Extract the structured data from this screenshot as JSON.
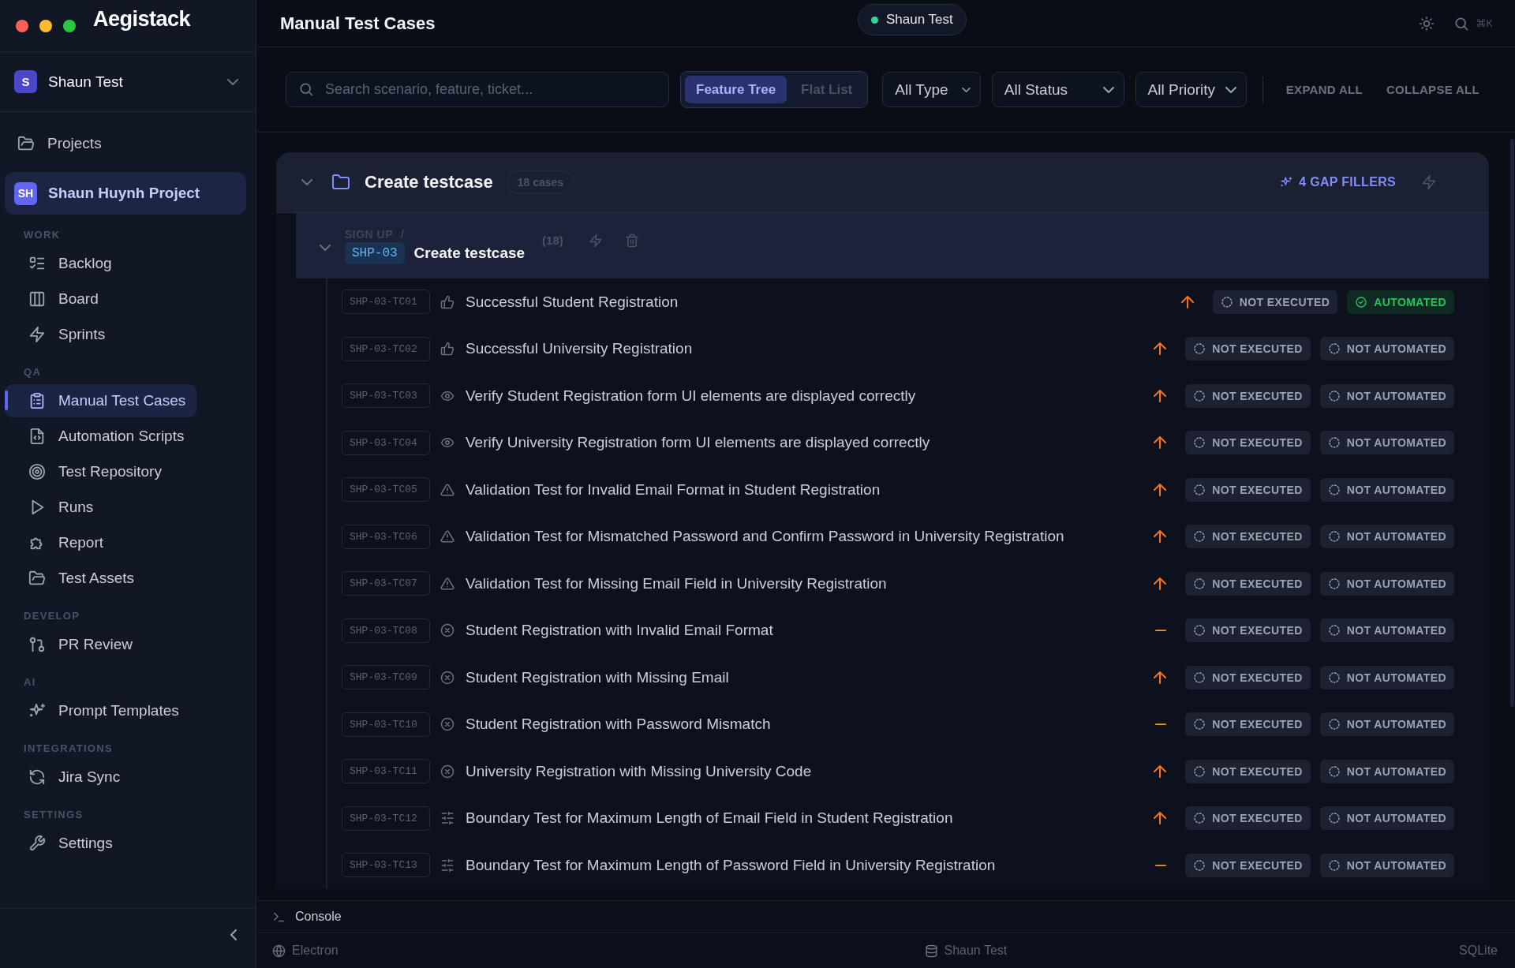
{
  "app": {
    "logo": "Aegistack"
  },
  "workspace": {
    "avatar": "S",
    "name": "Shaun Test"
  },
  "sidebar": {
    "projects_label": "Projects",
    "project": {
      "avatar": "SH",
      "name": "Shaun Huynh Project",
      "selected": true
    },
    "sections": [
      {
        "title": "WORK",
        "items": [
          {
            "kind": "backlog",
            "label": "Backlog",
            "selected": false
          },
          {
            "kind": "board",
            "label": "Board",
            "selected": false
          },
          {
            "kind": "sprints",
            "label": "Sprints",
            "selected": false
          }
        ]
      },
      {
        "title": "QA",
        "items": [
          {
            "kind": "manual",
            "label": "Manual Test Cases",
            "selected": true
          },
          {
            "kind": "scripts",
            "label": "Automation Scripts",
            "selected": false
          },
          {
            "kind": "repository",
            "label": "Test Repository",
            "selected": false
          },
          {
            "kind": "runs",
            "label": "Runs",
            "selected": false
          },
          {
            "kind": "report",
            "label": "Report",
            "selected": false
          },
          {
            "kind": "assets",
            "label": "Test Assets",
            "selected": false
          }
        ]
      },
      {
        "title": "DEVELOP",
        "items": [
          {
            "kind": "pr",
            "label": "PR Review",
            "selected": false
          }
        ]
      },
      {
        "title": "AI",
        "items": [
          {
            "kind": "prompts",
            "label": "Prompt Templates",
            "selected": false
          }
        ]
      },
      {
        "title": "INTEGRATIONS",
        "items": [
          {
            "kind": "sync",
            "label": "Jira Sync",
            "selected": false
          }
        ]
      },
      {
        "title": "SETTINGS",
        "items": [
          {
            "kind": "settings",
            "label": "Settings",
            "selected": false
          }
        ]
      }
    ]
  },
  "header": {
    "title": "Manual Test Cases",
    "connection": {
      "label": "Shaun Test",
      "online": true
    },
    "shortcut": "⌘K"
  },
  "filters": {
    "search": {
      "placeholder": "Search scenario, feature, ticket..."
    },
    "views": [
      {
        "label": "Feature Tree",
        "selected": true
      },
      {
        "label": "Flat List",
        "selected": false
      }
    ],
    "dropdowns": [
      "All Type",
      "All Status",
      "All Priority"
    ],
    "actions": [
      "EXPAND ALL",
      "COLLAPSE ALL"
    ]
  },
  "group": {
    "title": "Create testcase",
    "count": "18 cases",
    "expanded": true,
    "gap_fillers": "4 GAP FILLERS",
    "feature": {
      "breadcrumb": "SIGN UP",
      "separator": "/",
      "ticket": "SHP-03",
      "title": "Create testcase",
      "count": "(18)",
      "expanded": true
    },
    "cases": [
      {
        "id": "SHP-03-TC01",
        "kind": "positive",
        "title": "Successful Student Registration",
        "high_priority": true,
        "execution": "NOT EXECUTED",
        "automation": {
          "label": "AUTOMATED",
          "automated": true
        }
      },
      {
        "id": "SHP-03-TC02",
        "kind": "positive",
        "title": "Successful University Registration",
        "high_priority": true,
        "execution": "NOT EXECUTED",
        "automation": {
          "label": "NOT AUTOMATED",
          "automated": false
        }
      },
      {
        "id": "SHP-03-TC03",
        "kind": "ui",
        "title": "Verify Student Registration form UI elements are displayed correctly",
        "high_priority": true,
        "execution": "NOT EXECUTED",
        "automation": {
          "label": "NOT AUTOMATED",
          "automated": false
        }
      },
      {
        "id": "SHP-03-TC04",
        "kind": "ui",
        "title": "Verify University Registration form UI elements are displayed correctly",
        "high_priority": true,
        "execution": "NOT EXECUTED",
        "automation": {
          "label": "NOT AUTOMATED",
          "automated": false
        }
      },
      {
        "id": "SHP-03-TC05",
        "kind": "validation",
        "title": "Validation Test for Invalid Email Format in Student Registration",
        "high_priority": true,
        "execution": "NOT EXECUTED",
        "automation": {
          "label": "NOT AUTOMATED",
          "automated": false
        }
      },
      {
        "id": "SHP-03-TC06",
        "kind": "validation",
        "title": "Validation Test for Mismatched Password and Confirm Password in University Registration",
        "high_priority": true,
        "execution": "NOT EXECUTED",
        "automation": {
          "label": "NOT AUTOMATED",
          "automated": false
        }
      },
      {
        "id": "SHP-03-TC07",
        "kind": "validation",
        "title": "Validation Test for Missing Email Field in University Registration",
        "high_priority": true,
        "execution": "NOT EXECUTED",
        "automation": {
          "label": "NOT AUTOMATED",
          "automated": false
        }
      },
      {
        "id": "SHP-03-TC08",
        "kind": "negative",
        "title": "Student Registration with Invalid Email Format",
        "high_priority": false,
        "execution": "NOT EXECUTED",
        "automation": {
          "label": "NOT AUTOMATED",
          "automated": false
        }
      },
      {
        "id": "SHP-03-TC09",
        "kind": "negative",
        "title": "Student Registration with Missing Email",
        "high_priority": true,
        "execution": "NOT EXECUTED",
        "automation": {
          "label": "NOT AUTOMATED",
          "automated": false
        }
      },
      {
        "id": "SHP-03-TC10",
        "kind": "negative",
        "title": "Student Registration with Password Mismatch",
        "high_priority": false,
        "execution": "NOT EXECUTED",
        "automation": {
          "label": "NOT AUTOMATED",
          "automated": false
        }
      },
      {
        "id": "SHP-03-TC11",
        "kind": "negative",
        "title": "University Registration with Missing University Code",
        "high_priority": true,
        "execution": "NOT EXECUTED",
        "automation": {
          "label": "NOT AUTOMATED",
          "automated": false
        }
      },
      {
        "id": "SHP-03-TC12",
        "kind": "boundary",
        "title": "Boundary Test for Maximum Length of Email Field in Student Registration",
        "high_priority": true,
        "execution": "NOT EXECUTED",
        "automation": {
          "label": "NOT AUTOMATED",
          "automated": false
        }
      },
      {
        "id": "SHP-03-TC13",
        "kind": "boundary",
        "title": "Boundary Test for Maximum Length of Password Field in University Registration",
        "high_priority": false,
        "execution": "NOT EXECUTED",
        "automation": {
          "label": "NOT AUTOMATED",
          "automated": false
        }
      }
    ]
  },
  "console": {
    "label": "Console"
  },
  "status_bar": {
    "platform": "Electron",
    "database_name": "Shaun Test",
    "engine": "SQLite"
  }
}
